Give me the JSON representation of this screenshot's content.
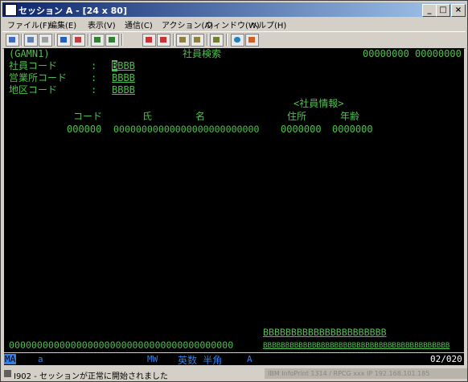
{
  "window": {
    "title": "セッション A - [24 x 80]",
    "min": "_",
    "max": "□",
    "close": "×"
  },
  "menu": [
    "ファイル(F)",
    "編集(E)",
    "表示(V)",
    "通信(C)",
    "アクション(A)",
    "ウィンドウ(W)",
    "ヘルプ(H)"
  ],
  "toolbar": {
    "icons": [
      "print-icon",
      "copy-icon",
      "paste-icon",
      "send-icon",
      "receive-icon",
      "display-icon",
      "macro-record-icon",
      "macro-stop-icon",
      "macro-play-icon",
      "macro-pause-icon",
      "clipboard-icon",
      "map-icon",
      "globe-icon",
      "keymap-icon"
    ],
    "colors": [
      "#3c6cc8",
      "#6080b0",
      "#a0a0a0",
      "#2060c0",
      "#c04040",
      "#308030",
      "#d03030",
      "#d03030",
      "#908040",
      "#908040",
      "#708030",
      "#4080c0",
      "#2080c0",
      "#d06020"
    ]
  },
  "screen": {
    "program_id": "(GAMN1)",
    "title": "社員検索",
    "top_right": "00000000 00000000",
    "fields": [
      {
        "label": "社員コード",
        "sep": ":",
        "cursor": "B",
        "value": "BBB"
      },
      {
        "label": "営業所コード",
        "sep": ":",
        "value": "BBBB"
      },
      {
        "label": "地区コード",
        "sep": ":",
        "value": "BBBB"
      }
    ],
    "section_heading": "<社員情報>",
    "headers": {
      "code": "コード",
      "last_name": "氏",
      "first_name": "名",
      "address": "住所",
      "age": "年齢"
    },
    "row": {
      "code": "000000",
      "name": "00000000000000000000000000",
      "address": "0000000",
      "age": "0000000"
    },
    "bottom_field_1": "BBBBBBBBBBBBBBBBBBBBBB",
    "bottom_zeros": "0000000000000000000000000000000000000000",
    "bottom_field_2": "BBBBBBBBBBBBBBBBBBBBBBBBBBBBBBBBBBBBBBBBBB"
  },
  "oia": {
    "ma": "MA",
    "a": "a",
    "mw": "MW",
    "mode": "英数 半角",
    "input": "A",
    "cursor_pos": "02/020"
  },
  "status": {
    "message": "I902 - セッションが正常に開始されました",
    "host": "IBM InfoPrint 1314 / RPCG xxx IP 192.168.101.185"
  }
}
